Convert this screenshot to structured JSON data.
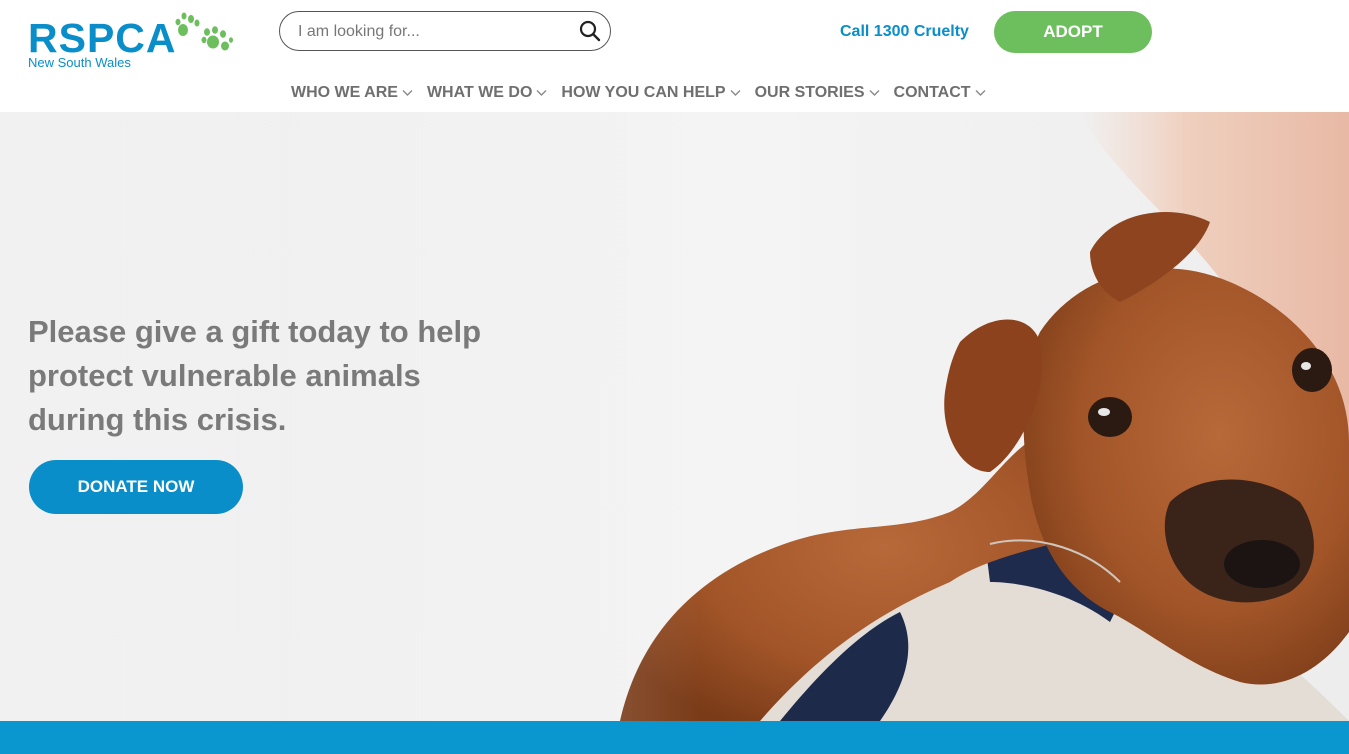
{
  "brand": {
    "name": "RSPCA",
    "region": "New South Wales",
    "primary_color": "#0a8ec9",
    "accent_green": "#6dbf5e"
  },
  "search": {
    "placeholder": "I am looking for...",
    "icon": "search-icon"
  },
  "header": {
    "call_label": "Call 1300 Cruelty",
    "adopt_label": "ADOPT"
  },
  "nav": {
    "items": [
      {
        "label": "WHO WE ARE",
        "icon": "chevron-down-icon"
      },
      {
        "label": "WHAT WE DO",
        "icon": "chevron-down-icon"
      },
      {
        "label": "HOW YOU CAN HELP",
        "icon": "chevron-down-icon"
      },
      {
        "label": "OUR STORIES",
        "icon": "chevron-down-icon"
      },
      {
        "label": "CONTACT",
        "icon": "chevron-down-icon"
      }
    ]
  },
  "hero": {
    "headline": "Please give a gift today to help protect vulnerable animals during this crisis.",
    "donate_label": "DONATE NOW"
  }
}
